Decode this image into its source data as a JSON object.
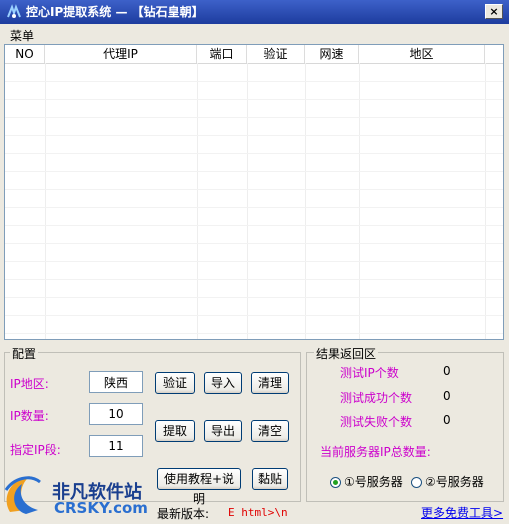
{
  "window": {
    "title": "控心IP提取系统 — 【钻石皇朝】",
    "close_label": "×"
  },
  "menu": {
    "label": "菜单"
  },
  "table": {
    "columns": [
      "NO",
      "代理IP",
      "端口",
      "验证",
      "网速",
      "地区"
    ],
    "rows": []
  },
  "config": {
    "title": "配置",
    "region_label": "IP地区:",
    "region_value": "陕西",
    "count_label": "IP数量:",
    "count_value": "10",
    "segment_label": "指定IP段:",
    "segment_value": "11",
    "buttons": {
      "verify": "验证",
      "import": "导入",
      "clean": "清理",
      "extract": "提取",
      "export": "导出",
      "clear": "清空",
      "tutorial": "使用教程+说明",
      "paste": "黏贴"
    }
  },
  "results": {
    "title": "结果返回区",
    "tested_label": "测试IP个数",
    "tested_value": "0",
    "success_label": "测试成功个数",
    "success_value": "0",
    "fail_label": "测试失败个数",
    "fail_value": "0",
    "server_total_label": "当前服务器IP总数量:",
    "server1_label": "①号服务器",
    "server2_label": "②号服务器",
    "selected_server": 1
  },
  "status": {
    "latest_label": "最新版本:",
    "latest_value": "E html>\\n",
    "more_link": "更多免费工具>"
  },
  "watermark": {
    "brand_cn": "非凡软件站",
    "brand_en": "CRSKY.com"
  },
  "colors": {
    "title_bar": "#1d3c9e",
    "label_magenta": "#cc00cc",
    "link_blue": "#0000ee",
    "version_red": "#e00000"
  }
}
